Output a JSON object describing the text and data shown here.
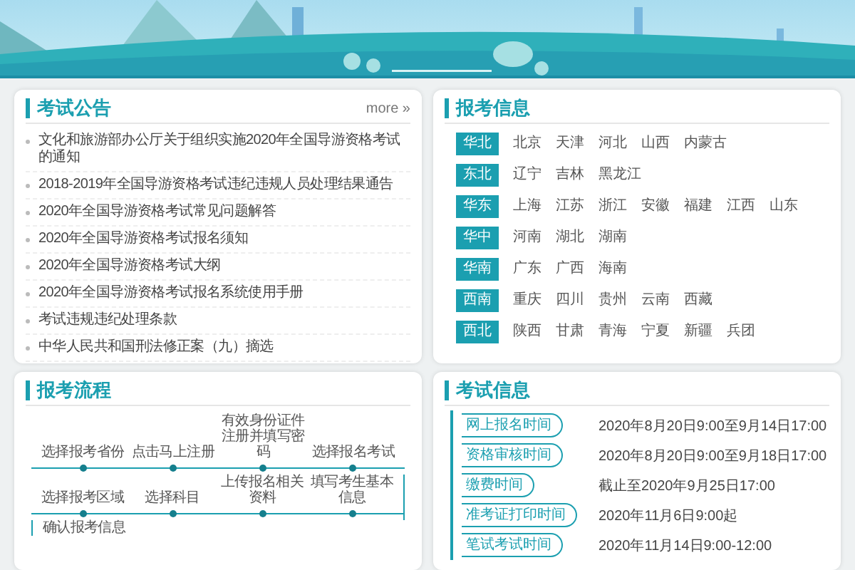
{
  "announcements": {
    "title": "考试公告",
    "more": "more »",
    "items": [
      "文化和旅游部办公厅关于组织实施2020年全国导游资格考试的通知",
      "2018-2019年全国导游资格考试违纪违规人员处理结果通告",
      "2020年全国导游资格考试常见问题解答",
      "2020年全国导游资格考试报名须知",
      "2020年全国导游资格考试大纲",
      "2020年全国导游资格考试报名系统使用手册",
      "考试违规违纪处理条款",
      "中华人民共和国刑法修正案（九）摘选"
    ]
  },
  "registration_info": {
    "title": "报考信息",
    "regions": [
      {
        "name": "华北",
        "provinces": [
          "北京",
          "天津",
          "河北",
          "山西",
          "内蒙古"
        ]
      },
      {
        "name": "东北",
        "provinces": [
          "辽宁",
          "吉林",
          "黑龙江"
        ]
      },
      {
        "name": "华东",
        "provinces": [
          "上海",
          "江苏",
          "浙江",
          "安徽",
          "福建",
          "江西",
          "山东"
        ]
      },
      {
        "name": "华中",
        "provinces": [
          "河南",
          "湖北",
          "湖南"
        ]
      },
      {
        "name": "华南",
        "provinces": [
          "广东",
          "广西",
          "海南"
        ]
      },
      {
        "name": "西南",
        "provinces": [
          "重庆",
          "四川",
          "贵州",
          "云南",
          "西藏"
        ]
      },
      {
        "name": "西北",
        "provinces": [
          "陕西",
          "甘肃",
          "青海",
          "宁夏",
          "新疆",
          "兵团"
        ]
      }
    ]
  },
  "process": {
    "title": "报考流程",
    "rows": [
      {
        "steps": [
          "选择报考省份",
          "点击马上注册",
          "有效身份证件注册并填写密码",
          "选择报名考试"
        ]
      },
      {
        "steps": [
          "选择报考区域",
          "选择科目",
          "上传报名相关资料",
          "填写考生基本信息"
        ]
      },
      {
        "steps": [
          "确认报考信息"
        ]
      }
    ]
  },
  "exam_info": {
    "title": "考试信息",
    "items": [
      {
        "label": "网上报名时间",
        "value": "2020年8月20日9:00至9月14日17:00"
      },
      {
        "label": "资格审核时间",
        "value": "2020年8月20日9:00至9月18日17:00"
      },
      {
        "label": "缴费时间",
        "value": "截止至2020年9月25日17:00"
      },
      {
        "label": "准考证打印时间",
        "value": "2020年11月6日9:00起"
      },
      {
        "label": "笔试考试时间",
        "value": "2020年11月14日9:00-12:00"
      }
    ]
  }
}
